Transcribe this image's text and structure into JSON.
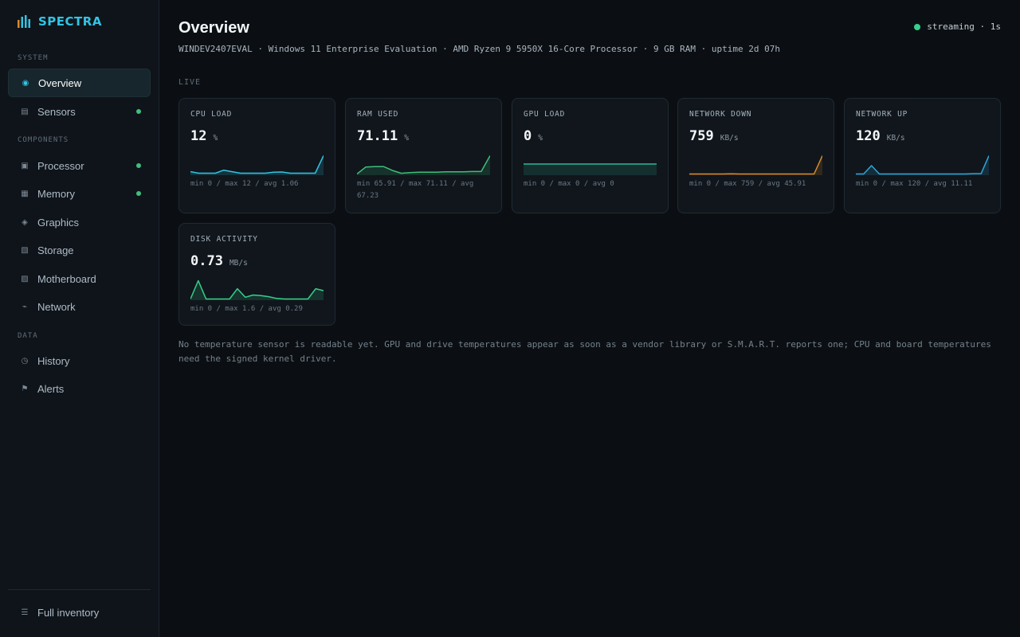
{
  "app": {
    "name": "SPECTRA",
    "logo_colors": [
      "#d98a2b",
      "#32c4e4",
      "#32c4e4",
      "#32c4e4"
    ]
  },
  "sidebar": {
    "sections": {
      "system": "SYSTEM",
      "components": "COMPONENTS",
      "data": "DATA"
    },
    "items": [
      {
        "label": "Overview",
        "icon": "target-icon",
        "glyph": "◉",
        "active": true,
        "dot": false
      },
      {
        "label": "Sensors",
        "icon": "list-icon",
        "glyph": "▤",
        "active": false,
        "dot": true
      },
      {
        "label": "Processor",
        "icon": "chip-icon",
        "glyph": "▣",
        "active": false,
        "dot": true
      },
      {
        "label": "Memory",
        "icon": "memory-icon",
        "glyph": "▦",
        "active": false,
        "dot": true
      },
      {
        "label": "Graphics",
        "icon": "graphics-icon",
        "glyph": "◈",
        "active": false,
        "dot": false
      },
      {
        "label": "Storage",
        "icon": "storage-icon",
        "glyph": "▧",
        "active": false,
        "dot": false
      },
      {
        "label": "Motherboard",
        "icon": "motherboard-icon",
        "glyph": "▨",
        "active": false,
        "dot": false
      },
      {
        "label": "Network",
        "icon": "network-icon",
        "glyph": "⌁",
        "active": false,
        "dot": false
      },
      {
        "label": "History",
        "icon": "clock-icon",
        "glyph": "◷",
        "active": false,
        "dot": false
      },
      {
        "label": "Alerts",
        "icon": "flag-icon",
        "glyph": "⚑",
        "active": false,
        "dot": false
      }
    ],
    "footer": {
      "label": "Full inventory",
      "icon": "inventory-icon",
      "glyph": "☰"
    }
  },
  "header": {
    "title": "Overview",
    "system_line": "WINDEV2407EVAL · Windows 11 Enterprise Evaluation · AMD Ryzen 9 5950X 16-Core Processor · 9 GB RAM · uptime 2d 07h",
    "status": "streaming · 1s",
    "status_color": "#36d08a"
  },
  "live_label": "LIVE",
  "cards": [
    {
      "label": "CPU LOAD",
      "value": "12",
      "unit": "%",
      "stats": "min 0 / max 12 / avg 1.06",
      "color": "#32c4e4",
      "series": [
        1.5,
        0.5,
        0.5,
        0.5,
        2.5,
        1.5,
        0.5,
        0.5,
        0.5,
        0.5,
        1.2,
        1.3,
        0.5,
        0.5,
        0.5,
        0.5,
        12
      ],
      "max": 12
    },
    {
      "label": "RAM USED",
      "value": "71.11",
      "unit": "%",
      "stats": "min 65.91 / max 71.11 / avg 67.23",
      "color": "#3fbf7a",
      "series": [
        65.9,
        67.9,
        68.0,
        68.0,
        66.9,
        66.1,
        66.3,
        66.4,
        66.4,
        66.4,
        66.5,
        66.5,
        66.5,
        66.6,
        66.6,
        71.1
      ],
      "min": 65.9,
      "max": 71.1
    },
    {
      "label": "GPU LOAD",
      "value": "0",
      "unit": "%",
      "stats": "min 0 / max 0 / avg 0",
      "color": "#2fb597",
      "series": [
        0,
        0,
        0,
        0,
        0,
        0,
        0,
        0,
        0,
        0,
        0,
        0,
        0,
        0,
        0,
        0
      ],
      "flat": true
    },
    {
      "label": "NETWORK DOWN",
      "value": "759",
      "unit": "KB/s",
      "stats": "min 0 / max 759 / avg 45.91",
      "color": "#d98a2b",
      "series": [
        0,
        0,
        0,
        0,
        0,
        5,
        0,
        0,
        0,
        0,
        0,
        0,
        0,
        0,
        0,
        0,
        759
      ],
      "max": 759
    },
    {
      "label": "NETWORK UP",
      "value": "120",
      "unit": "KB/s",
      "stats": "min 0 / max 120 / avg 11.11",
      "color": "#2fa6d8",
      "series": [
        0,
        0,
        55,
        0,
        0,
        0,
        0,
        0,
        0,
        0,
        0,
        0,
        0,
        0,
        0,
        2,
        2,
        120
      ],
      "max": 120
    },
    {
      "label": "DISK ACTIVITY",
      "value": "0.73",
      "unit": "MB/s",
      "stats": "min 0 / max 1.6 / avg 0.29",
      "color": "#36d08a",
      "series": [
        0,
        1.6,
        0,
        0,
        0,
        0,
        0.9,
        0.15,
        0.35,
        0.3,
        0.2,
        0.05,
        0,
        0,
        0,
        0,
        0.9,
        0.73
      ],
      "max": 1.6
    }
  ],
  "footnote": "No temperature sensor is readable yet. GPU and drive temperatures appear as soon as a vendor library or S.M.A.R.T. reports one; CPU and board temperatures need the signed kernel driver."
}
